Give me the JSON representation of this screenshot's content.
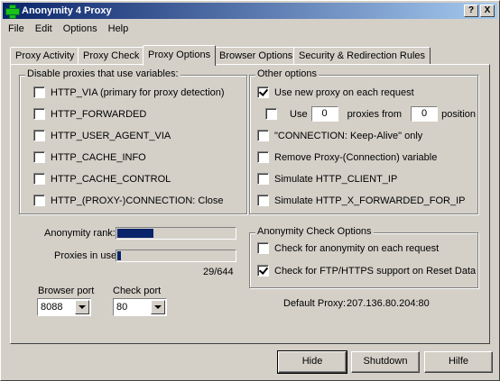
{
  "window": {
    "title": "Anonymity 4 Proxy",
    "help_btn": "?",
    "close_btn": "X"
  },
  "menu": [
    "File",
    "Edit",
    "Options",
    "Help"
  ],
  "tabs": [
    "Proxy Activity",
    "Proxy Check",
    "Proxy Options",
    "Browser Options",
    "Security & Redirection Rules"
  ],
  "active_tab": "Proxy Options",
  "disable_group": {
    "title": "Disable proxies that use variables:",
    "items": [
      {
        "label": "HTTP_VIA (primary for proxy detection)",
        "checked": false
      },
      {
        "label": "HTTP_FORWARDED",
        "checked": false
      },
      {
        "label": "HTTP_USER_AGENT_VIA",
        "checked": false
      },
      {
        "label": "HTTP_CACHE_INFO",
        "checked": false
      },
      {
        "label": "HTTP_CACHE_CONTROL",
        "checked": false
      },
      {
        "label": "HTTP_(PROXY-)CONNECTION: Close",
        "checked": false
      }
    ]
  },
  "other_group": {
    "title": "Other options",
    "new_proxy": {
      "label": "Use new proxy on each request",
      "checked": true
    },
    "use_row": {
      "use_label": "Use",
      "use_value": "0",
      "proxies_from_label": "proxies from",
      "from_value": "0",
      "position_label": "position",
      "checked": false
    },
    "items": [
      {
        "label": "\"CONNECTION: Keep-Alive\" only",
        "checked": false
      },
      {
        "label": "Remove Proxy-(Connection) variable",
        "checked": false
      },
      {
        "label": "Simulate HTTP_CLIENT_IP",
        "checked": false
      },
      {
        "label": "Simulate HTTP_X_FORWARDED_FOR_IP",
        "checked": false
      }
    ]
  },
  "rank": {
    "anonymity_label": "Anonymity rank:",
    "anonymity_value": 0.32,
    "proxies_label": "Proxies in use",
    "proxies_value": 0.045,
    "count": "29/644"
  },
  "ports": {
    "browser_label": "Browser port",
    "browser_value": "8088",
    "check_label": "Check port",
    "check_value": "80"
  },
  "check_group": {
    "title": "Anonymity Check Options",
    "items": [
      {
        "label": "Check for anonymity on each request",
        "checked": false
      },
      {
        "label": "Check for FTP/HTTPS support on Reset Data",
        "checked": true
      }
    ]
  },
  "default_proxy": {
    "label": "Default Proxy:",
    "value": "207.136.80.204:80"
  },
  "buttons": {
    "hide": "Hide",
    "shutdown": "Shutdown",
    "help": "Hilfe"
  }
}
